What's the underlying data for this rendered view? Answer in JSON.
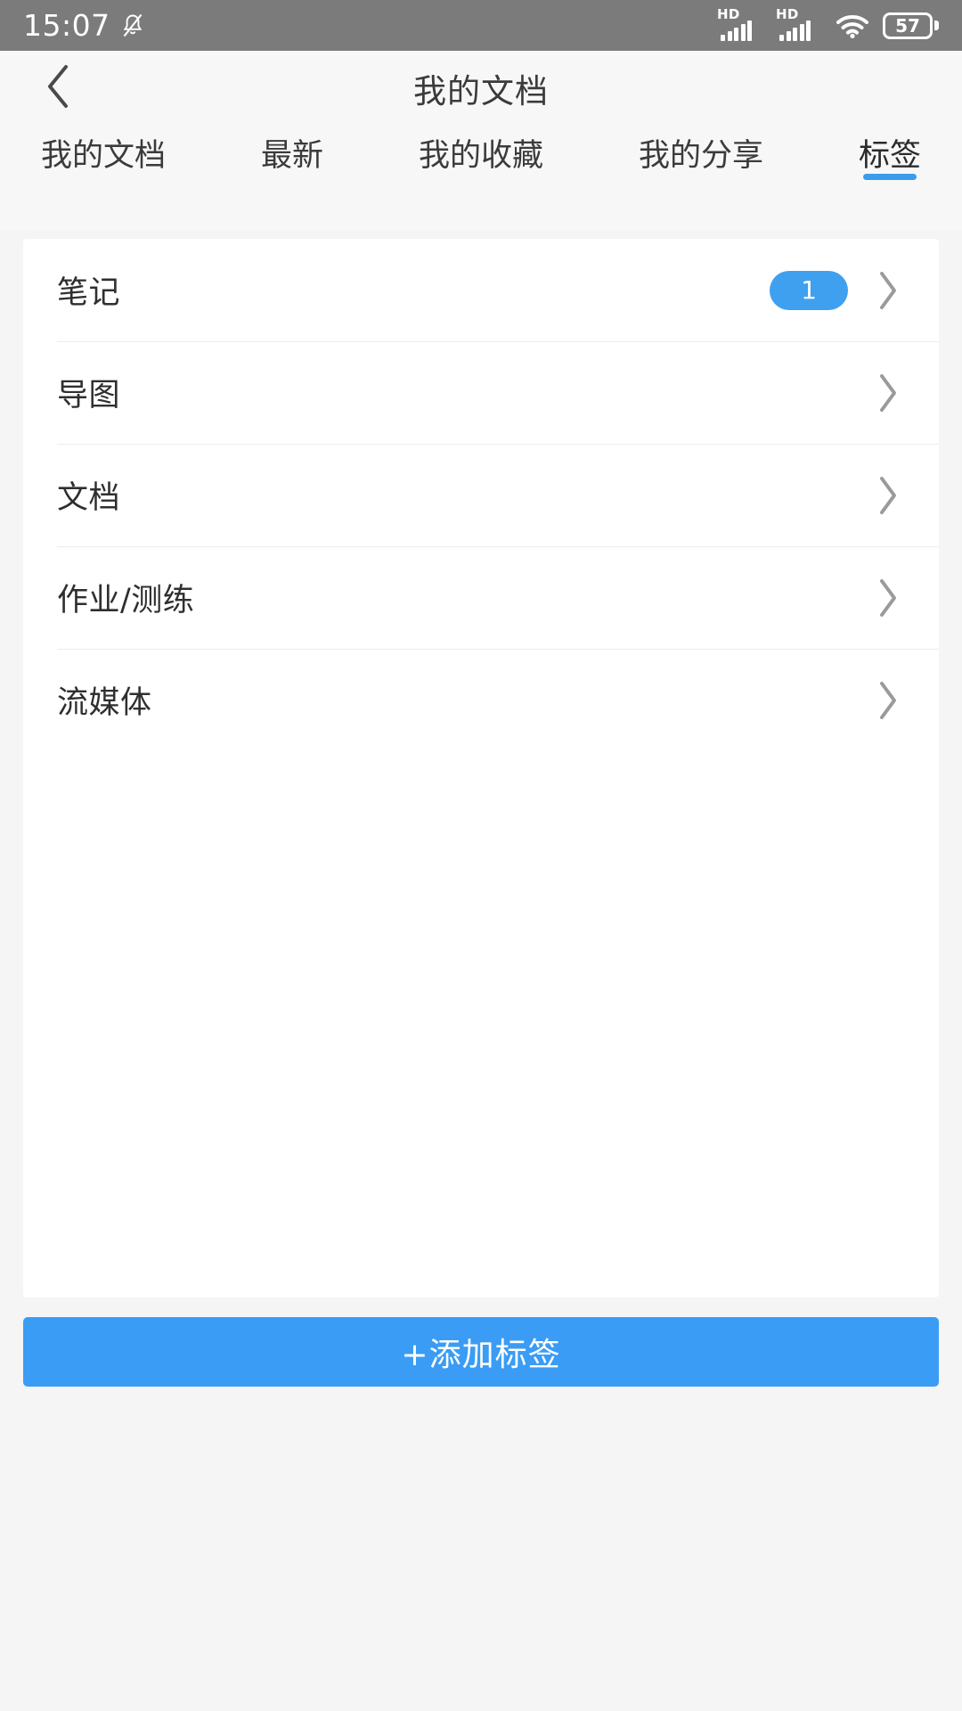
{
  "status_bar": {
    "time": "15:07",
    "mute_icon": "bell-muted-icon",
    "signal_1_label": "HD",
    "signal_2_label": "HD",
    "wifi_icon": "wifi-icon",
    "battery_level": "57"
  },
  "header": {
    "back_icon": "back-chevron-icon",
    "title": "我的文档"
  },
  "tabs": [
    {
      "label": "我的文档",
      "active": false
    },
    {
      "label": "最新",
      "active": false
    },
    {
      "label": "我的收藏",
      "active": false
    },
    {
      "label": "我的分享",
      "active": false
    },
    {
      "label": "标签",
      "active": true
    }
  ],
  "list": {
    "rows": [
      {
        "label": "笔记",
        "badge": "1",
        "chevron": "chevron-right-icon"
      },
      {
        "label": "导图",
        "badge": "",
        "chevron": "chevron-right-icon"
      },
      {
        "label": "文档",
        "badge": "",
        "chevron": "chevron-right-icon"
      },
      {
        "label": "作业/测练",
        "badge": "",
        "chevron": "chevron-right-icon"
      },
      {
        "label": "流媒体",
        "badge": "",
        "chevron": "chevron-right-icon"
      }
    ]
  },
  "footer": {
    "add_tag_label": "+添加标签"
  },
  "colors": {
    "accent": "#3a9cf5",
    "badge": "#3fa0f0",
    "tab_indicator": "#3a9ceb",
    "status_bar_bg": "#7b7b7b",
    "page_bg": "#f5f5f5",
    "card_bg": "#ffffff"
  }
}
